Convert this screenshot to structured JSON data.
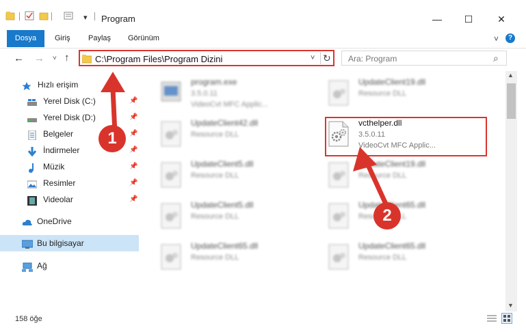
{
  "window": {
    "title": "Program",
    "minimize": "—",
    "maximize": "☐",
    "close": "✕"
  },
  "quick_access_dropdown": "▾",
  "ribbon": {
    "tabs": [
      "Dosya",
      "Giriş",
      "Paylaş",
      "Görünüm"
    ],
    "collapse_icon": "˅",
    "help_icon": "?"
  },
  "nav": {
    "back": "←",
    "forward": "→",
    "recent": "˅",
    "up": "↑",
    "address": "C:\\Program Files\\Program Dizini",
    "address_dropdown": "˅",
    "refresh": "↻",
    "search_placeholder": "Ara: Program",
    "search_icon": "⌕"
  },
  "sidebar": {
    "quick_access": "Hızlı erişim",
    "items": [
      {
        "label": "Yerel Disk (C:)",
        "pinned": "📌"
      },
      {
        "label": "Yerel Disk (D:)",
        "pinned": "📌"
      },
      {
        "label": "Belgeler",
        "pinned": "📌"
      },
      {
        "label": "İndirmeler",
        "pinned": "📌"
      },
      {
        "label": "Müzik",
        "pinned": "📌"
      },
      {
        "label": "Resimler",
        "pinned": "📌"
      },
      {
        "label": "Videolar",
        "pinned": "📌"
      }
    ],
    "onedrive": "OneDrive",
    "this_pc": "Bu bilgisayar",
    "network": "Ağ"
  },
  "files": [
    {
      "name": "program.exe",
      "line2": "3.5.0.11",
      "line3": "VideoCvt MFC Applic..."
    },
    {
      "name": "UpdateClient19.dll",
      "line2": "Resource DLL",
      "line3": ""
    },
    {
      "name": "UpdateClient42.dll",
      "line2": "Resource DLL",
      "line3": ""
    },
    {
      "name": "vcthelper.dll",
      "line2": "3.5.0.11",
      "line3": "VideoCvt MFC Applic..."
    },
    {
      "name": "UpdateClient5.dll",
      "line2": "Resource DLL",
      "line3": ""
    },
    {
      "name": "UpdateClient19.dll",
      "line2": "Resource DLL",
      "line3": ""
    },
    {
      "name": "UpdateClient5.dll",
      "line2": "Resource DLL",
      "line3": ""
    },
    {
      "name": "UpdateClient65.dll",
      "line2": "Resource DLL",
      "line3": ""
    },
    {
      "name": "UpdateClient65.dll",
      "line2": "Resource DLL",
      "line3": ""
    },
    {
      "name": "UpdateClient65.dll",
      "line2": "Resource DLL",
      "line3": ""
    }
  ],
  "annotations": {
    "step1": "1",
    "step2": "2"
  },
  "status": {
    "count": "158 öğe"
  },
  "colors": {
    "accent": "#1979ca",
    "highlight": "#d9342b",
    "selected": "#cce4f7"
  }
}
